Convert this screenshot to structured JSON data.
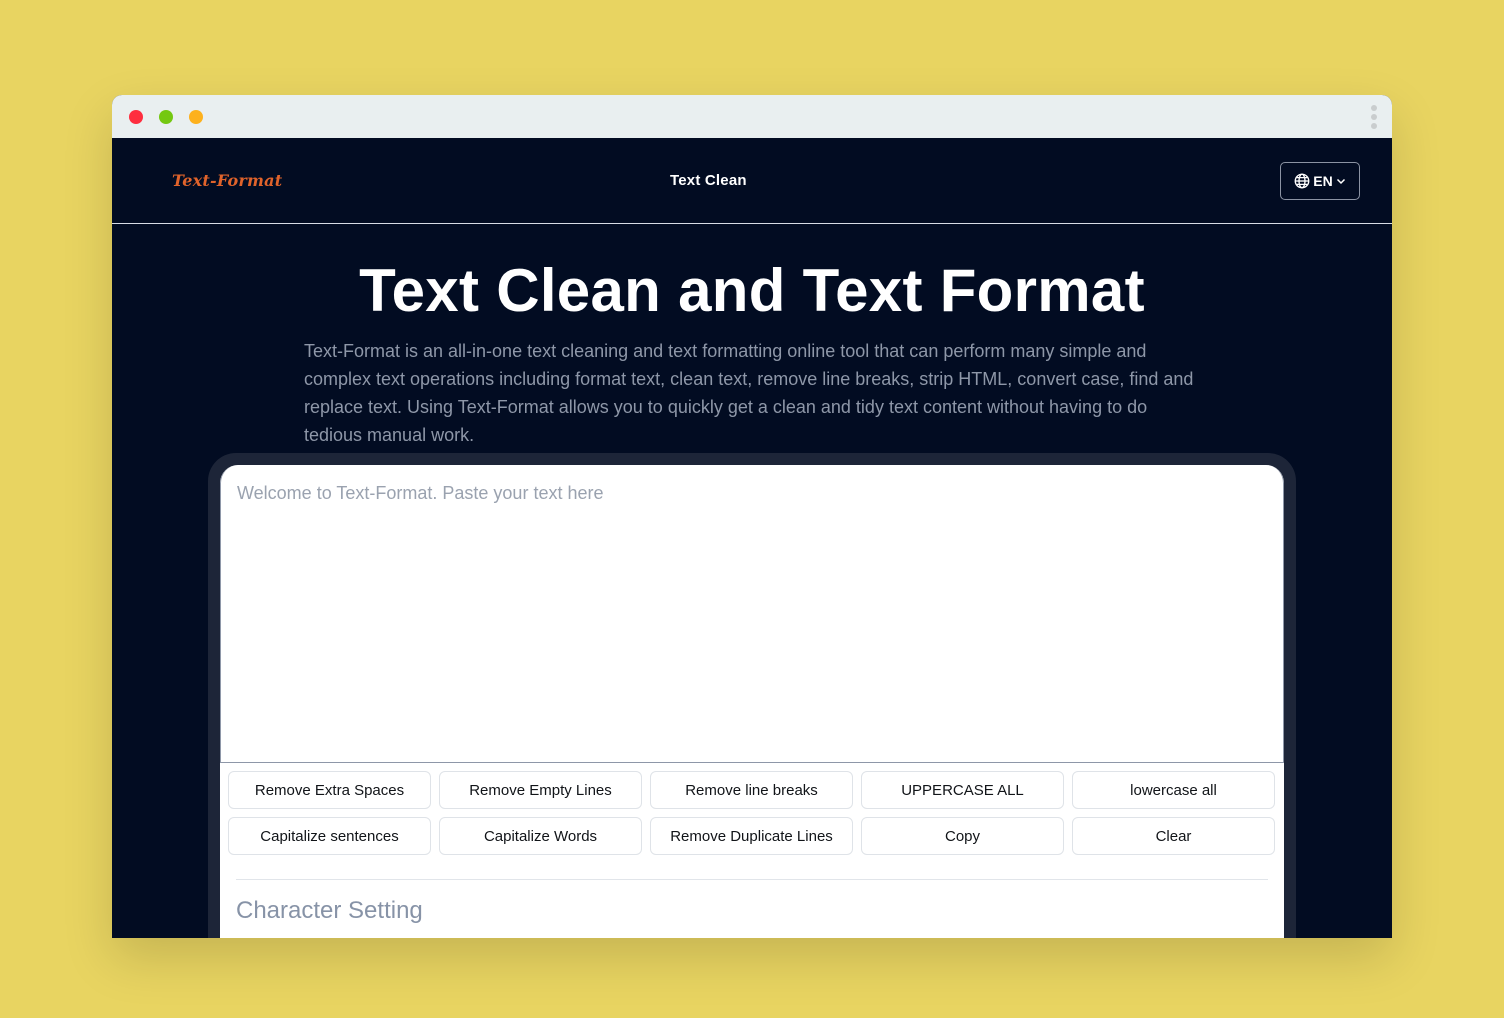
{
  "app": {
    "logo": "Text-Format",
    "nav_link": "Text Clean",
    "language": "EN"
  },
  "hero": {
    "title": "Text Clean and Text Format",
    "description": "Text-Format is an all-in-one text cleaning and text formatting online tool that can perform many simple and complex text operations including format text, clean text, remove line breaks, strip HTML, convert case, find and replace text. Using Text-Format allows you to quickly get a clean and tidy text content without having to do tedious manual work."
  },
  "editor": {
    "value": "",
    "placeholder": "Welcome to Text-Format. Paste your text here"
  },
  "operations": [
    "Remove Extra Spaces",
    "Remove Empty Lines",
    "Remove line breaks",
    "UPPERCASE ALL",
    "lowercase all",
    "Capitalize sentences",
    "Capitalize Words",
    "Remove Duplicate Lines",
    "Copy",
    "Clear"
  ],
  "section": {
    "title": "Character Setting"
  },
  "icons": {
    "language": "globe-icon",
    "dropdown": "chevron-down-icon",
    "menu": "kebab-menu-icon"
  },
  "colors": {
    "background": "#e8d461",
    "page": "#020c22",
    "accent": "#e0632b",
    "titlebar": "#e9eff0",
    "muted_text": "#8e97a8"
  }
}
